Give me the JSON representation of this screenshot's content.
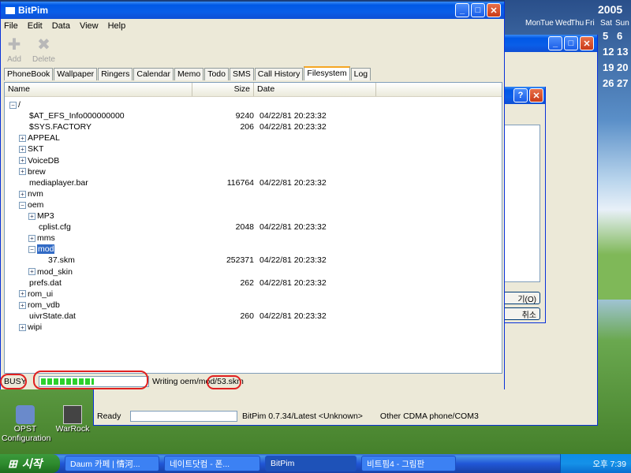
{
  "main_window": {
    "title": "BitPim",
    "menu": [
      "File",
      "Edit",
      "Data",
      "View",
      "Help"
    ],
    "toolbar": [
      {
        "label": "Add",
        "icon": "add-icon"
      },
      {
        "label": "Delete",
        "icon": "delete-icon"
      }
    ],
    "tabs": [
      "PhoneBook",
      "Wallpaper",
      "Ringers",
      "Calendar",
      "Memo",
      "Todo",
      "SMS",
      "Call History",
      "Filesystem",
      "Log"
    ],
    "active_tab": "Filesystem",
    "columns": [
      "Name",
      "Size",
      "Date"
    ],
    "tree": [
      {
        "name": "/",
        "expander": "−",
        "size": "",
        "date": ""
      },
      {
        "name": "$AT_EFS_Info000000000",
        "expander": "",
        "size": "9240",
        "date": "04/22/81 20:23:32"
      },
      {
        "name": "$SYS.FACTORY",
        "expander": "",
        "size": "206",
        "date": "04/22/81 20:23:32"
      },
      {
        "name": "APPEAL",
        "expander": "+",
        "size": "",
        "date": ""
      },
      {
        "name": "SKT",
        "expander": "+",
        "size": "",
        "date": ""
      },
      {
        "name": "VoiceDB",
        "expander": "+",
        "size": "",
        "date": ""
      },
      {
        "name": "brew",
        "expander": "+",
        "size": "",
        "date": ""
      },
      {
        "name": "mediaplayer.bar",
        "expander": "",
        "size": "116764",
        "date": "04/22/81 20:23:32"
      },
      {
        "name": "nvm",
        "expander": "+",
        "size": "",
        "date": ""
      },
      {
        "name": "oem",
        "expander": "−",
        "size": "",
        "date": ""
      },
      {
        "name": "MP3",
        "expander": "+",
        "size": "",
        "date": ""
      },
      {
        "name": "cplist.cfg",
        "expander": "",
        "size": "2048",
        "date": "04/22/81 20:23:32"
      },
      {
        "name": "mms",
        "expander": "+",
        "size": "",
        "date": ""
      },
      {
        "name": "mod",
        "expander": "−",
        "size": "",
        "date": ""
      },
      {
        "name": "37.skm",
        "expander": "",
        "size": "252371",
        "date": "04/22/81 20:23:32"
      },
      {
        "name": "mod_skin",
        "expander": "+",
        "size": "",
        "date": ""
      },
      {
        "name": "prefs.dat",
        "expander": "",
        "size": "262",
        "date": "04/22/81 20:23:32"
      },
      {
        "name": "rom_ui",
        "expander": "+",
        "size": "",
        "date": ""
      },
      {
        "name": "rom_vdb",
        "expander": "+",
        "size": "",
        "date": ""
      },
      {
        "name": "uivrState.dat",
        "expander": "",
        "size": "260",
        "date": "04/22/81 20:23:32"
      },
      {
        "name": "wipi",
        "expander": "+",
        "size": "",
        "date": ""
      }
    ],
    "status": {
      "state": "BUSY",
      "progress": 0.5,
      "message": "Writing oem/mod/53.skm"
    }
  },
  "back_window": {
    "status": {
      "ready": "Ready",
      "version": "BitPim 0.7.34/Latest <Unknown>",
      "phone": "Other CDMA phone/COM3"
    }
  },
  "dialog": {
    "button1": "기(O)",
    "button2": "취소"
  },
  "calendar": {
    "year": "2005",
    "days": [
      "Mon",
      "Tue",
      "Wed",
      "Thu",
      "Fri",
      "Sat",
      "Sun"
    ],
    "dates": [
      "5",
      "6",
      "12",
      "13",
      "19",
      "20",
      "26",
      "27"
    ]
  },
  "desktop_icons": [
    {
      "label": "OPST Configuration",
      "icon": "opst-icon"
    },
    {
      "label": "WarRock",
      "icon": "warrock-icon"
    }
  ],
  "taskbar": {
    "start": "시작",
    "tasks": [
      "Daum 카페 | 情河...",
      "네이트닷컴 - 폰...",
      "BitPim",
      "비트핌4 - 그림판"
    ],
    "clock": "오후 7:39"
  }
}
